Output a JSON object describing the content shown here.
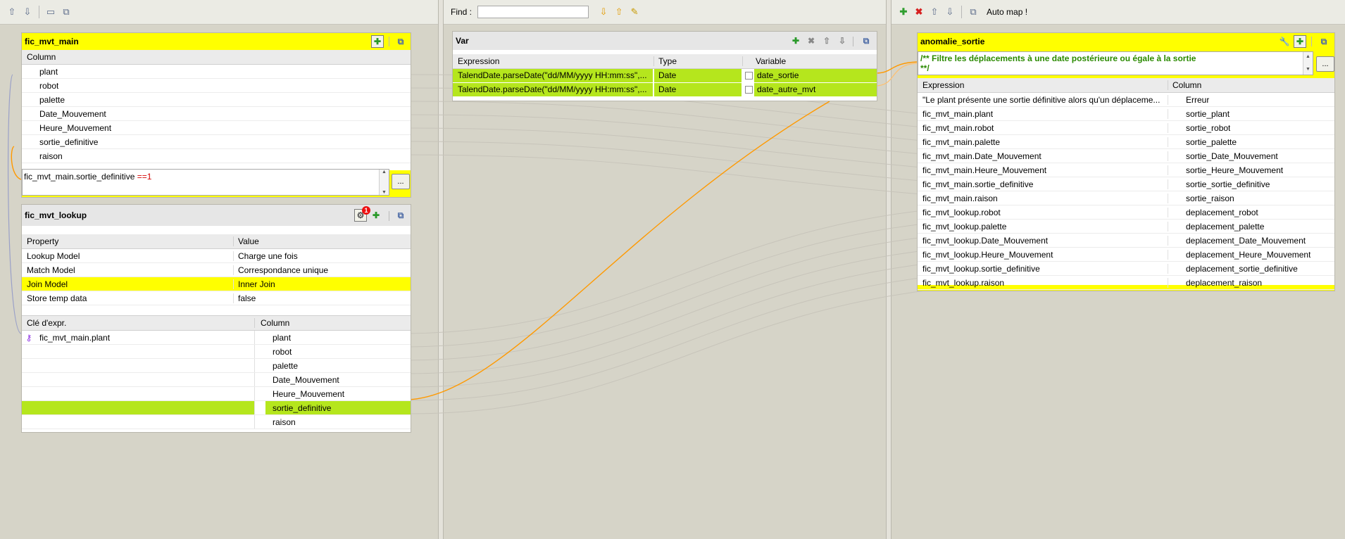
{
  "left_panel": {
    "main_table": {
      "title": "fic_mvt_main",
      "column_header": "Column",
      "columns": [
        "plant",
        "robot",
        "palette",
        "Date_Mouvement",
        "Heure_Mouvement",
        "sortie_definitive",
        "raison"
      ],
      "filter_expr_prefix": "fic_mvt_main.sortie_definitive ",
      "filter_expr_operator": "==1",
      "dots_label": "..."
    },
    "lookup_table": {
      "title": "fic_mvt_lookup",
      "badge": "1",
      "property_header": "Property",
      "value_header": "Value",
      "properties": [
        {
          "name": "Lookup Model",
          "value": "Charge une fois"
        },
        {
          "name": "Match Model",
          "value": "Correspondance unique"
        },
        {
          "name": "Join Model",
          "value": "Inner Join"
        },
        {
          "name": "Store temp data",
          "value": "false"
        }
      ],
      "key_header": "Clé d'expr.",
      "column_header": "Column",
      "rows": [
        {
          "key": "fic_mvt_main.plant",
          "column": "plant"
        },
        {
          "key": "",
          "column": "robot"
        },
        {
          "key": "",
          "column": "palette"
        },
        {
          "key": "",
          "column": "Date_Mouvement"
        },
        {
          "key": "",
          "column": "Heure_Mouvement"
        },
        {
          "key": "",
          "column": "sortie_definitive"
        },
        {
          "key": "",
          "column": "raison"
        }
      ]
    }
  },
  "middle_panel": {
    "find_label": "Find :",
    "find_value": "",
    "var_table": {
      "title": "Var",
      "headers": {
        "expression": "Expression",
        "type": "Type",
        "variable": "Variable"
      },
      "rows": [
        {
          "expression": "TalendDate.parseDate(\"dd/MM/yyyy HH:mm:ss\",...",
          "type": "Date",
          "variable": "date_sortie"
        },
        {
          "expression": "TalendDate.parseDate(\"dd/MM/yyyy HH:mm:ss\",...",
          "type": "Date",
          "variable": "date_autre_mvt"
        }
      ]
    }
  },
  "right_panel": {
    "auto_map_label": "Auto map !",
    "output_table": {
      "title": "anomalie_sortie",
      "comment_line1": "/** Filtre les déplacements à une date postérieure ou égale à la sortie",
      "comment_line2": "**/",
      "dots_label": "...",
      "expression_header": "Expression",
      "column_header": "Column",
      "rows": [
        {
          "expression": "\"Le plant présente une sortie définitive alors qu'un déplaceme...",
          "column": "Erreur"
        },
        {
          "expression": "fic_mvt_main.plant",
          "column": "sortie_plant"
        },
        {
          "expression": "fic_mvt_main.robot",
          "column": "sortie_robot"
        },
        {
          "expression": "fic_mvt_main.palette",
          "column": "sortie_palette"
        },
        {
          "expression": "fic_mvt_main.Date_Mouvement",
          "column": "sortie_Date_Mouvement"
        },
        {
          "expression": "fic_mvt_main.Heure_Mouvement",
          "column": "sortie_Heure_Mouvement"
        },
        {
          "expression": "fic_mvt_main.sortie_definitive",
          "column": "sortie_sortie_definitive"
        },
        {
          "expression": "fic_mvt_main.raison",
          "column": "sortie_raison"
        },
        {
          "expression": "fic_mvt_lookup.robot",
          "column": "deplacement_robot"
        },
        {
          "expression": "fic_mvt_lookup.palette",
          "column": "deplacement_palette"
        },
        {
          "expression": "fic_mvt_lookup.Date_Mouvement",
          "column": "deplacement_Date_Mouvement"
        },
        {
          "expression": "fic_mvt_lookup.Heure_Mouvement",
          "column": "deplacement_Heure_Mouvement"
        },
        {
          "expression": "fic_mvt_lookup.sortie_definitive",
          "column": "deplacement_sortie_definitive"
        },
        {
          "expression": "fic_mvt_lookup.raison",
          "column": "deplacement_raison"
        }
      ]
    }
  },
  "colors": {
    "highlight_yellow": "#ffff00",
    "highlight_green": "#b5e61d",
    "link_orange": "#ff9900",
    "comment_green": "#2a8a00",
    "operator_red": "#d40000"
  }
}
